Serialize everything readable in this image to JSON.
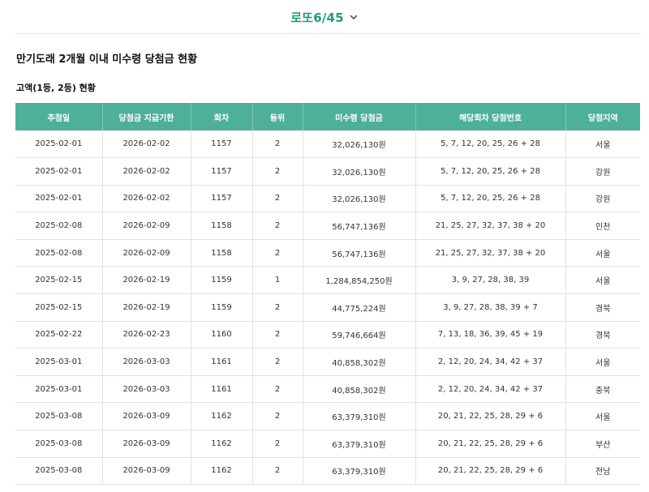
{
  "header": {
    "game_select": "로또6/45",
    "icon": "chevron-down-icon"
  },
  "section": {
    "title": "만기도래 2개월 이내 미수령 당첨금 현황",
    "subtitle": "고액(1등, 2등) 현황"
  },
  "colors": {
    "accent": "#1c9d7d",
    "table_header": "#4fb09a"
  },
  "table": {
    "columns": [
      "추첨일",
      "당첨금 지급기한",
      "회차",
      "등위",
      "미수령 당첨금",
      "해당회차 당첨번호",
      "당첨지역"
    ],
    "rows": [
      [
        "2025-02-01",
        "2026-02-02",
        "1157",
        "2",
        "32,026,130원",
        "5, 7, 12, 20, 25, 26 + 28",
        "서울"
      ],
      [
        "2025-02-01",
        "2026-02-02",
        "1157",
        "2",
        "32,026,130원",
        "5, 7, 12, 20, 25, 26 + 28",
        "강원"
      ],
      [
        "2025-02-01",
        "2026-02-02",
        "1157",
        "2",
        "32,026,130원",
        "5, 7, 12, 20, 25, 26 + 28",
        "강원"
      ],
      [
        "2025-02-08",
        "2026-02-09",
        "1158",
        "2",
        "56,747,136원",
        "21, 25, 27, 32, 37, 38 + 20",
        "인천"
      ],
      [
        "2025-02-08",
        "2026-02-09",
        "1158",
        "2",
        "56,747,136원",
        "21, 25, 27, 32, 37, 38 + 20",
        "서울"
      ],
      [
        "2025-02-15",
        "2026-02-19",
        "1159",
        "1",
        "1,284,854,250원",
        "3, 9, 27, 28, 38, 39",
        "서울"
      ],
      [
        "2025-02-15",
        "2026-02-19",
        "1159",
        "2",
        "44,775,224원",
        "3, 9, 27, 28, 38, 39 + 7",
        "경북"
      ],
      [
        "2025-02-22",
        "2026-02-23",
        "1160",
        "2",
        "59,746,664원",
        "7, 13, 18, 36, 39, 45 + 19",
        "경북"
      ],
      [
        "2025-03-01",
        "2026-03-03",
        "1161",
        "2",
        "40,858,302원",
        "2, 12, 20, 24, 34, 42 + 37",
        "서울"
      ],
      [
        "2025-03-01",
        "2026-03-03",
        "1161",
        "2",
        "40,858,302원",
        "2, 12, 20, 24, 34, 42 + 37",
        "충북"
      ],
      [
        "2025-03-08",
        "2026-03-09",
        "1162",
        "2",
        "63,379,310원",
        "20, 21, 22, 25, 28, 29 + 6",
        "서울"
      ],
      [
        "2025-03-08",
        "2026-03-09",
        "1162",
        "2",
        "63,379,310원",
        "20, 21, 22, 25, 28, 29 + 6",
        "부산"
      ],
      [
        "2025-03-08",
        "2026-03-09",
        "1162",
        "2",
        "63,379,310원",
        "20, 21, 22, 25, 28, 29 + 6",
        "전남"
      ]
    ]
  }
}
